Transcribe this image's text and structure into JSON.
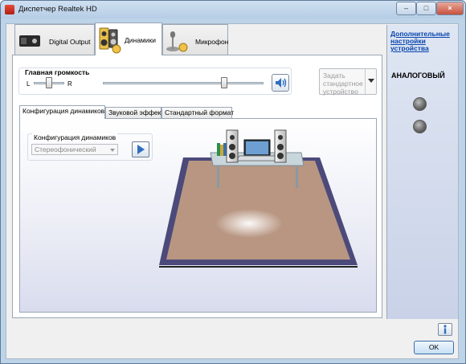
{
  "window": {
    "title": "Диспетчер Realtek HD",
    "minimize_glyph": "–",
    "maximize_glyph": "□",
    "close_glyph": "×",
    "app_icon": "realtek-icon"
  },
  "device_tabs": [
    {
      "label": "Digital Output",
      "icon": "digital-output-icon",
      "active": false
    },
    {
      "label": "Динамики",
      "icon": "speakers-icon",
      "active": true
    },
    {
      "label": "Микрофон",
      "icon": "microphone-icon",
      "active": false
    }
  ],
  "main_volume": {
    "label": "Главная громкость",
    "left_label": "L",
    "right_label": "R",
    "balance": 0.5,
    "level": 0.65,
    "mute_icon": "speaker-volume-icon"
  },
  "default_device": {
    "label": "Задать стандартное устройство",
    "dropdown_icon": "dropdown-arrow-icon"
  },
  "sub_tabs": [
    {
      "label": "Конфигурация динамиков",
      "active": true
    },
    {
      "label": "Звуковой эффект",
      "active": false
    },
    {
      "label": "Стандартный формат",
      "active": false
    }
  ],
  "speaker_config": {
    "group_label": "Конфигурация динамиков",
    "selected": "Стереофонический",
    "play_icon": "play-icon"
  },
  "right_pane": {
    "advanced_link": "Дополнительные настройки устройства",
    "analog_header": "АНАЛОГОВЫЙ",
    "jacks": [
      "jack-1",
      "jack-2"
    ]
  },
  "footer": {
    "info_icon": "info-icon",
    "ok_label": "OK"
  },
  "colors": {
    "accent_blue": "#2f6fc0",
    "floor": "#b89682",
    "floor_border": "#4c4a7a",
    "link": "#0645ad"
  }
}
